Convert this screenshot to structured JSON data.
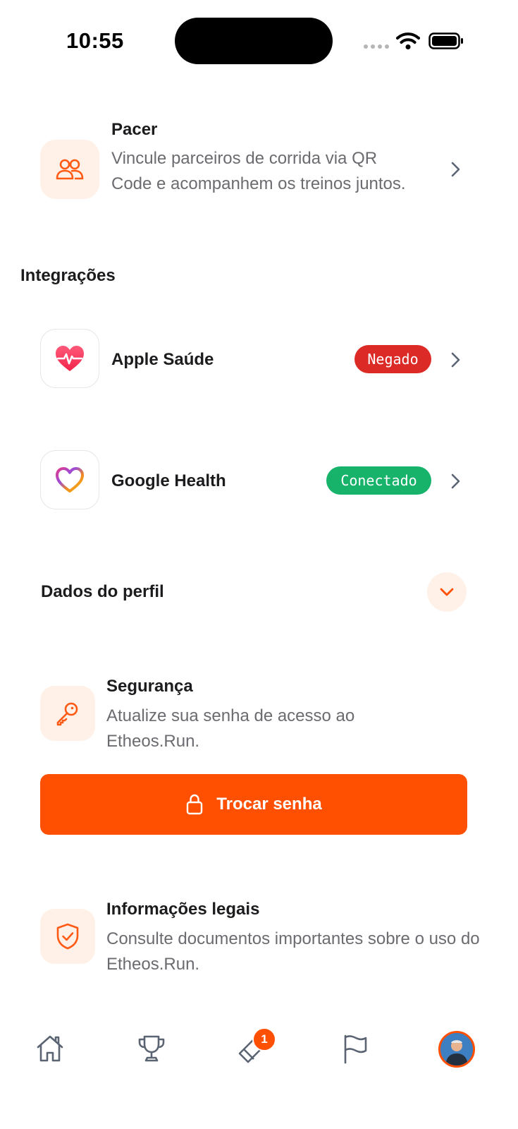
{
  "status_bar": {
    "time": "10:55"
  },
  "pacer": {
    "title": "Pacer",
    "description": "Vincule parceiros de corrida via QR Code e acompanhem os treinos juntos."
  },
  "integrations": {
    "heading": "Integrações",
    "items": [
      {
        "label": "Apple Saúde",
        "status": "Negado",
        "status_color": "#dc2a27"
      },
      {
        "label": "Google Health",
        "status": "Conectado",
        "status_color": "#17b36b"
      }
    ]
  },
  "profile": {
    "heading": "Dados do perfil"
  },
  "security": {
    "title": "Segurança",
    "description": "Atualize sua senha de acesso ao Etheos.Run.",
    "button_label": "Trocar senha"
  },
  "legal": {
    "title": "Informações legais",
    "description": "Consulte documentos importantes sobre o uso do Etheos.Run."
  },
  "tab_bar": {
    "tabs": [
      "home-icon",
      "trophy-icon",
      "tag-icon",
      "flag-icon",
      "profile-avatar"
    ],
    "notification_count": "1"
  },
  "colors": {
    "accent": "#ff4f00",
    "accent_soft": "#fff1e8",
    "text_secondary": "#6b6b70"
  }
}
